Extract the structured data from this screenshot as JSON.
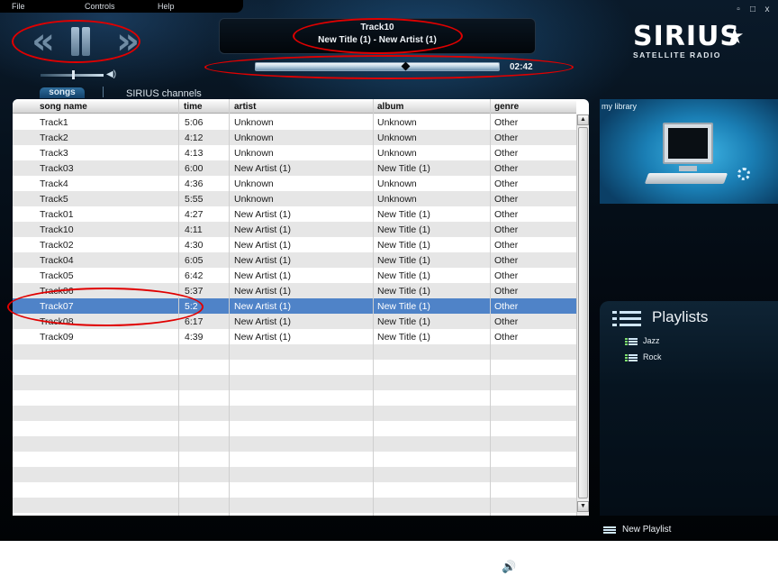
{
  "menu": {
    "file": "File",
    "controls": "Controls",
    "help": "Help"
  },
  "window": {
    "minimize": "▫",
    "restore": "□",
    "close": "x"
  },
  "transport": {
    "previous_icon": "previous-icon",
    "pause_icon": "pause-icon",
    "next_icon": "next-icon"
  },
  "volume_level": 0.5,
  "now_playing": {
    "track": "Track10",
    "info": "New Title (1)  -  New Artist (1)",
    "elapsed": "02:42",
    "progress": 0.62
  },
  "logo": {
    "main": "SIRIUS",
    "sub": "SATELLITE RADIO"
  },
  "tabs": {
    "songs": "songs",
    "channels": "SIRIUS channels"
  },
  "table": {
    "columns": [
      "song name",
      "time",
      "artist",
      "album",
      "genre"
    ],
    "rows": [
      [
        "Track1",
        "5:06",
        "Unknown",
        "Unknown",
        "Other"
      ],
      [
        "Track2",
        "4:12",
        "Unknown",
        "Unknown",
        "Other"
      ],
      [
        "Track3",
        "4:13",
        "Unknown",
        "Unknown",
        "Other"
      ],
      [
        "Track03",
        "6:00",
        "New Artist (1)",
        "New Title (1)",
        "Other"
      ],
      [
        "Track4",
        "4:36",
        "Unknown",
        "Unknown",
        "Other"
      ],
      [
        "Track5",
        "5:55",
        "Unknown",
        "Unknown",
        "Other"
      ],
      [
        "Track01",
        "4:27",
        "New Artist (1)",
        "New Title (1)",
        "Other"
      ],
      [
        "Track10",
        "4:11",
        "New Artist (1)",
        "New Title (1)",
        "Other"
      ],
      [
        "Track02",
        "4:30",
        "New Artist (1)",
        "New Title (1)",
        "Other"
      ],
      [
        "Track04",
        "6:05",
        "New Artist (1)",
        "New Title (1)",
        "Other"
      ],
      [
        "Track05",
        "6:42",
        "New Artist (1)",
        "New Title (1)",
        "Other"
      ],
      [
        "Track06",
        "5:37",
        "New Artist (1)",
        "New Title (1)",
        "Other"
      ],
      [
        "Track07",
        "5:2",
        "New Artist (1)",
        "New Title (1)",
        "Other"
      ],
      [
        "Track08",
        "6:17",
        "New Artist (1)",
        "New Title (1)",
        "Other"
      ],
      [
        "Track09",
        "4:39",
        "New Artist (1)",
        "New Title (1)",
        "Other"
      ]
    ],
    "selected_index": 12,
    "total_rows": 26
  },
  "library": {
    "label": "my library"
  },
  "playlists": {
    "title": "Playlists",
    "items": [
      "Jazz",
      "Rock"
    ],
    "new_label": "New Playlist"
  },
  "colors": {
    "accent": "#4f83c8",
    "annotation": "#e00000"
  }
}
